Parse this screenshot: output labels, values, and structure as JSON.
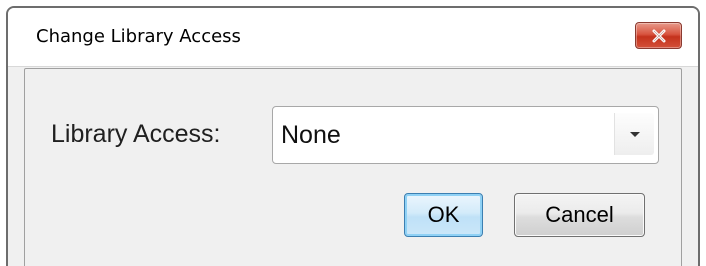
{
  "window": {
    "title": "Change Library Access",
    "close_icon": "close-x-icon"
  },
  "form": {
    "library_access_label": "Library Access:",
    "library_access_value": "None",
    "dropdown_icon": "chevron-down-icon"
  },
  "buttons": {
    "ok_label": "OK",
    "cancel_label": "Cancel"
  },
  "colors": {
    "close_button": "#c4321c",
    "ok_button_border": "#3c7fb1",
    "dialog_background": "#f0f0f0"
  }
}
